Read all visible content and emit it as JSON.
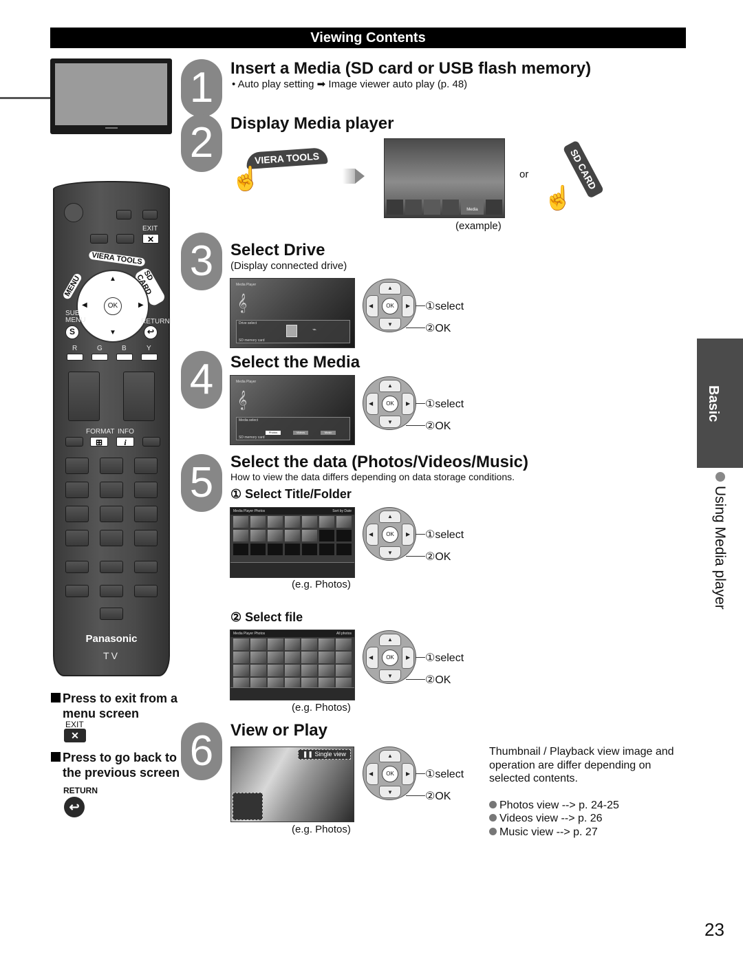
{
  "header": {
    "title": "Viewing Contents"
  },
  "page_number": "23",
  "side_tab": {
    "section": "Basic",
    "topic": "Using Media player"
  },
  "remote": {
    "exit_label": "EXIT",
    "viera_tools_label": "VIERA TOOLS",
    "menu_label": "MENU",
    "sd_card_label": "SD CARD",
    "ok_label": "OK",
    "sub_menu_label": "SUB\nMENU",
    "return_label": "RETURN",
    "s_label": "S",
    "color_labels": [
      "R",
      "G",
      "B",
      "Y"
    ],
    "format_label": "FORMAT",
    "info_label": "INFO",
    "info_glyph": "i",
    "brand": "Panasonic",
    "brand_sub": "TV"
  },
  "notes": {
    "exit_note": "Press to exit from a menu screen",
    "exit_key_label": "EXIT",
    "exit_glyph": "✕",
    "return_note": "Press to go back to the previous screen",
    "return_key_label": "RETURN",
    "return_glyph": "↩"
  },
  "steps": [
    {
      "number": "1",
      "title": "Insert a Media (SD card or USB flash memory)",
      "sub": "• Auto play setting ➡ Image viewer auto play (p. 48)"
    },
    {
      "number": "2",
      "title": "Display Media player",
      "or_label": "or",
      "example_caption": "(example)",
      "viera_tools_label": "VIERA TOOLS",
      "sd_card_label": "SD CARD",
      "example_tile_label": "Media player"
    },
    {
      "number": "3",
      "title": "Select Drive",
      "sub": "(Display connected drive)",
      "screen_title": "Media Player",
      "screen_panel": "Drive select",
      "screen_status": "SD memory card"
    },
    {
      "number": "4",
      "title": "Select the Media",
      "screen_title": "Media Player",
      "screen_panel": "Media select",
      "media_options": [
        "Photos",
        "Videos",
        "Music"
      ],
      "screen_status": "SD memory card"
    },
    {
      "number": "5",
      "title": "Select the data (Photos/Videos/Music)",
      "sub": "How to view the data differs depending on data storage conditions.",
      "substeps": [
        {
          "label": "① Select Title/Folder",
          "caption": "(e.g. Photos)",
          "screen_header_left": "Media Player  Photos",
          "screen_header_right": "Sort by Date"
        },
        {
          "label": "② Select file",
          "caption": "(e.g. Photos)",
          "screen_header_left": "Media Player  Photos",
          "screen_header_right": "All photos"
        }
      ]
    },
    {
      "number": "6",
      "title": "View or Play",
      "caption": "(e.g. Photos)",
      "overlay_label": "Single view"
    }
  ],
  "controls": {
    "select_label": "①select",
    "ok_label": "②OK",
    "ok_key": "OK"
  },
  "info": {
    "text": "Thumbnail / Playback view image and operation are differ depending on selected contents.",
    "links": [
      "Photos view --> p. 24-25",
      "Videos view --> p. 26",
      "Music view --> p. 27"
    ]
  },
  "colors": {
    "header_bg": "#000000",
    "step_circle": "#878787",
    "side_tab": "#4b4b4b",
    "bullet": "#777777"
  }
}
